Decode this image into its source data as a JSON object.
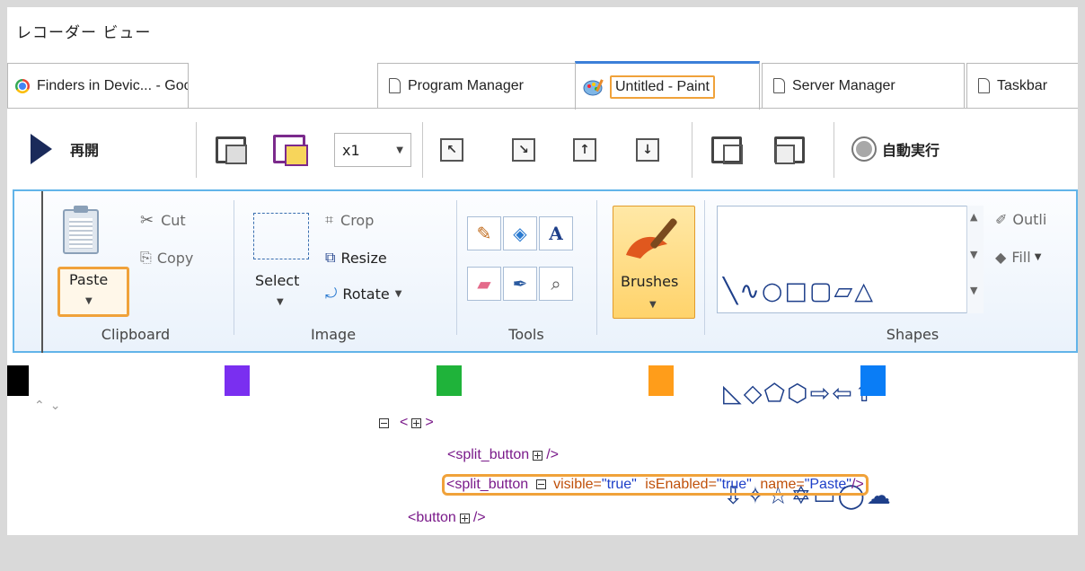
{
  "window": {
    "title": "レコーダー ビュー"
  },
  "tabs": [
    {
      "label": "Finders in Devic... - Google Chrome",
      "icon": "chrome-icon",
      "active": false
    },
    {
      "label": "Program Manager",
      "icon": "document-icon",
      "active": false
    },
    {
      "label": "Untitled - Paint",
      "icon": "paint-icon",
      "active": true
    },
    {
      "label": "Server Manager",
      "icon": "document-icon",
      "active": false
    },
    {
      "label": "Taskbar",
      "icon": "document-icon",
      "active": false
    }
  ],
  "toolbar": {
    "resume_label": "再開",
    "speed_value": "x1",
    "auto_run_label": "自動実行"
  },
  "ribbon": {
    "clipboard": {
      "cut_label": "Cut",
      "copy_label": "Copy",
      "paste_label": "Paste",
      "group_label": "Clipboard"
    },
    "image": {
      "select_label": "Select",
      "crop_label": "Crop",
      "resize_label": "Resize",
      "rotate_label": "Rotate",
      "group_label": "Image"
    },
    "tools": {
      "group_label": "Tools",
      "text_tool_glyph": "A"
    },
    "brushes": {
      "label": "Brushes"
    },
    "shapes": {
      "outline_label": "Outli",
      "fill_label": "Fill",
      "group_label": "Shapes",
      "row1": "╲∿○□▢▱△",
      "row2": "◺◇⬠⬡⇨⇦⇧",
      "row3": "⇩✧☆✡▭◯☁"
    }
  },
  "colors": {
    "swatches": [
      "#000000",
      "#7a2ff0",
      "#1fb33a",
      "#ff9d1a",
      "#0a7df6"
    ]
  },
  "tree": {
    "root_open": "<",
    "root_close": ">",
    "node1_tag": "<split_button",
    "node1_close": "/>",
    "node2_tag": "<split_button",
    "node2_visible_attr": "visible=",
    "node2_visible_val": "\"true\"",
    "node2_enabled_attr": "isEnabled=",
    "node2_enabled_val": "\"true\"",
    "node2_name_attr": "name=",
    "node2_name_val": "\"Paste\"",
    "node2_close": "/>",
    "node3_tag": "<button",
    "node3_close": "/>"
  },
  "accent": {
    "highlight": "#f0a23a",
    "ribbon_border": "#62b4e9",
    "tab_active": "#3c7fd8"
  }
}
